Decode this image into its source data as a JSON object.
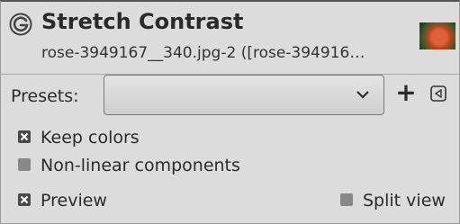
{
  "dialog": {
    "title": "Stretch Contrast",
    "subtitle": "rose-3949167__340.jpg-2 ([rose-394916…",
    "icon": "gimp-icon",
    "thumbnail": "rose-thumbnail"
  },
  "presets": {
    "label": "Presets:",
    "value": "",
    "add_label": "+",
    "manage_icon": "presets-menu-icon"
  },
  "options": {
    "keep_colors": {
      "label": "Keep colors",
      "checked": true
    },
    "non_linear": {
      "label": "Non-linear components",
      "checked": false
    }
  },
  "footer": {
    "preview": {
      "label": "Preview",
      "checked": true
    },
    "split_view": {
      "label": "Split view",
      "checked": false
    }
  },
  "colors": {
    "background": "#dcdcdc",
    "text": "#2b2b2b",
    "checkbox_checked": "#4a4a4a",
    "checkbox_unchecked": "#888888"
  }
}
